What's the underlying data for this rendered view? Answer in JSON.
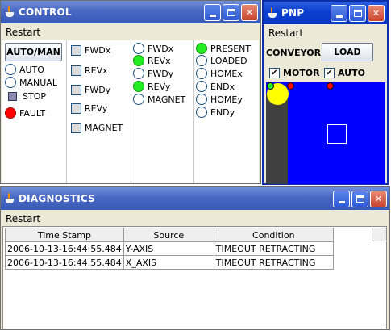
{
  "control": {
    "title": "CONTROL",
    "menu": "Restart",
    "automan_label": "AUTO/MAN",
    "auto_label": "AUTO",
    "manual_label": "MANUAL",
    "stop_label": "STOP",
    "fault_label": "FAULT",
    "outputs": [
      "FWDx",
      "REVx",
      "FWDy",
      "REVy",
      "MAGNET"
    ],
    "inputs_a": [
      "FWDx",
      "REVx",
      "FWDy",
      "REVy",
      "MAGNET"
    ],
    "inputs_b": [
      "PRESENT",
      "LOADED",
      "HOMEx",
      "ENDx",
      "HOMEy",
      "ENDy"
    ]
  },
  "pnp": {
    "title": "PNP",
    "menu": "Restart",
    "conveyor_label": "CONVEYOR",
    "load_label": "LOAD",
    "motor_label": "MOTOR",
    "auto_label": "AUTO",
    "motor_checked": "✔",
    "auto_checked": "✔"
  },
  "diagnostics": {
    "title": "DIAGNOSTICS",
    "menu": "Restart",
    "columns": [
      "Time Stamp",
      "Source",
      "Condition"
    ],
    "rows": [
      [
        "2006-10-13-16:44:55.484",
        "Y-AXIS",
        "TIMEOUT RETRACTING"
      ],
      [
        "2006-10-13-16:44:55.484",
        "X_AXIS",
        "TIMEOUT RETRACTING"
      ]
    ]
  },
  "colors": {
    "indicator_on": "#22ee22",
    "fault": "#ff0000",
    "field": "#0000ff",
    "gripper": "#ffff00"
  }
}
